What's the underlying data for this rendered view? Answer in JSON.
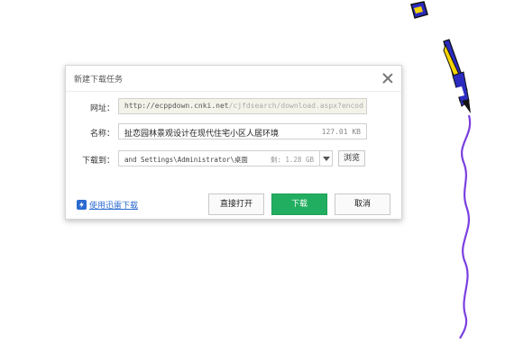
{
  "dialog": {
    "title": "新建下载任务",
    "url_label": "网址：",
    "url_prefix": "http://ecppdown.cnki.net",
    "url_rest": "/cjfdsearch/download.aspx?encod",
    "name_label": "名称：",
    "file_name": "扯恋园林景观设计在现代住宅小区人居环境",
    "file_size": "127.01 KB",
    "path_label": "下载到：",
    "path_value": "and Settings\\Administrator\\桌面",
    "free_space": "剩: 1.28 GB",
    "browse_label": "浏览",
    "thunder_link": "使用迅雷下载",
    "open_label": "直接打开",
    "download_label": "下载",
    "cancel_label": "取消"
  },
  "colors": {
    "download_button": "#22ae60",
    "link": "#2a6ad0",
    "pencil_scribble": "#7a3fe0"
  },
  "icons": {
    "close": "close-icon",
    "dropdown": "chevron-down-icon",
    "thunder": "thunder-icon",
    "decoration": "pencil-icon"
  }
}
